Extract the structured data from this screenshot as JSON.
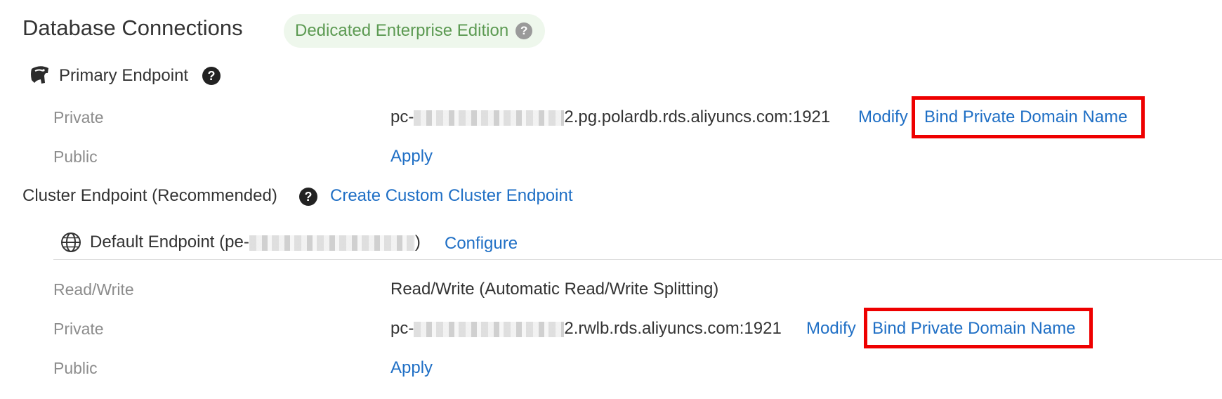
{
  "header": {
    "title": "Database Connections",
    "edition_badge": "Dedicated Enterprise Edition",
    "help_glyph": "?"
  },
  "primary": {
    "section_label": "Primary Endpoint",
    "help_glyph": "?",
    "rows": {
      "private_label": "Private",
      "private_prefix": "pc-",
      "private_suffix": "2.pg.polardb.rds.aliyuncs.com:1921",
      "modify": "Modify",
      "bind": "Bind Private Domain Name",
      "public_label": "Public",
      "apply": "Apply"
    }
  },
  "cluster": {
    "section_label": "Cluster Endpoint (Recommended)",
    "help_glyph": "?",
    "create_link": "Create Custom Cluster Endpoint",
    "default_endpoint": {
      "label_prefix": "Default Endpoint (pe-",
      "label_suffix": ")",
      "configure": "Configure"
    },
    "rows": {
      "rw_label": "Read/Write",
      "rw_value": "Read/Write (Automatic Read/Write Splitting)",
      "private_label": "Private",
      "private_prefix": "pc-",
      "private_suffix": "2.rwlb.rds.aliyuncs.com:1921",
      "modify": "Modify",
      "bind": "Bind Private Domain Name",
      "public_label": "Public",
      "apply": "Apply"
    }
  },
  "icons": {
    "primary": "elephant-icon",
    "default_endpoint": "globe-icon",
    "help": "question-circle-icon"
  },
  "colors": {
    "link": "#1f6fc5",
    "badge_bg": "#eef7ec",
    "badge_text": "#5c9a52",
    "highlight": "#ee0000",
    "muted_label": "#8c8c8c"
  }
}
